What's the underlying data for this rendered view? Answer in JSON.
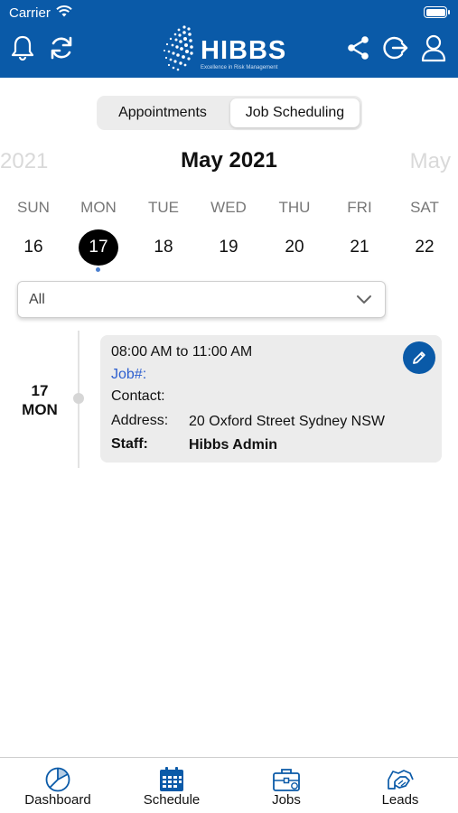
{
  "status_bar": {
    "carrier": "Carrier"
  },
  "header": {
    "logo_text": "HIBBS",
    "logo_tagline": "Excellence in Risk Management",
    "icons": [
      "bell-icon",
      "refresh-icon",
      "share-icon",
      "logout-icon",
      "profile-icon"
    ],
    "color": "#0a5aa8"
  },
  "segment": {
    "options": [
      "Appointments",
      "Job Scheduling"
    ],
    "selected": "Job Scheduling"
  },
  "calendar": {
    "prev_month": "2021",
    "current_month": "May 2021",
    "next_month": "May",
    "weekdays": [
      "SUN",
      "MON",
      "TUE",
      "WED",
      "THU",
      "FRI",
      "SAT"
    ],
    "dates": [
      "16",
      "17",
      "18",
      "19",
      "20",
      "21",
      "22"
    ],
    "selected_date": "17"
  },
  "filter": {
    "value": "All"
  },
  "timeline": {
    "date_day": "17",
    "date_weekday": "MON",
    "entry": {
      "time": "08:00 AM to 11:00 AM",
      "job_label": "Job#:",
      "contact_label": "Contact:",
      "address_label": "Address:",
      "address_value": "20 Oxford Street Sydney NSW",
      "staff_label": "Staff:",
      "staff_value": "Hibbs Admin"
    }
  },
  "tabbar": {
    "tabs": [
      {
        "label": "Dashboard",
        "icon": "pie-chart-icon"
      },
      {
        "label": "Schedule",
        "icon": "calendar-icon"
      },
      {
        "label": "Jobs",
        "icon": "briefcase-icon"
      },
      {
        "label": "Leads",
        "icon": "handshake-icon"
      }
    ],
    "active": "Schedule",
    "active_color": "#0a5aa8"
  }
}
